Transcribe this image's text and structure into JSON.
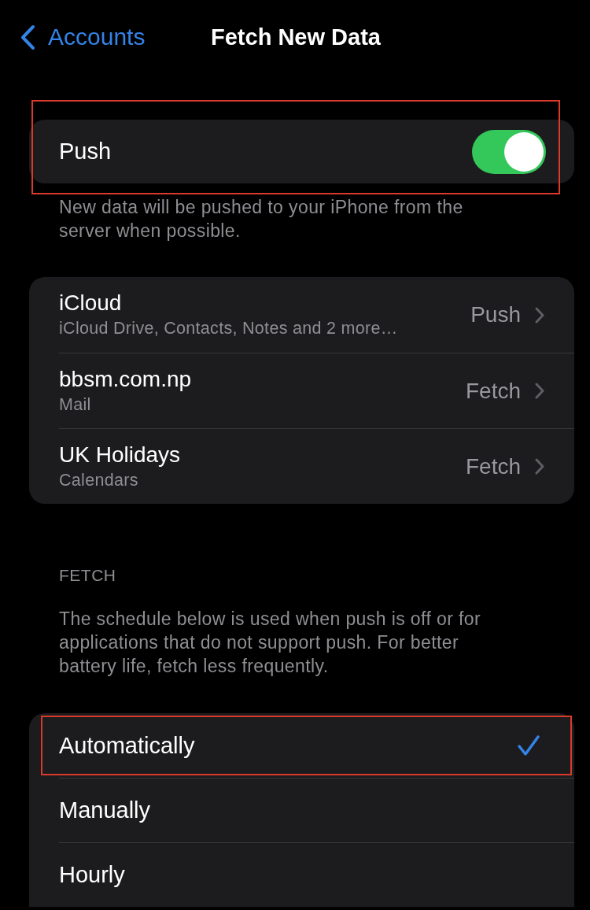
{
  "nav": {
    "back_label": "Accounts",
    "title": "Fetch New Data"
  },
  "push": {
    "label": "Push",
    "on": true,
    "highlighted": true,
    "footer": "New data will be pushed to your iPhone from the server when possible."
  },
  "accounts": [
    {
      "name": "iCloud",
      "detail": "iCloud Drive, Contacts, Notes and 2 more…",
      "value": "Push"
    },
    {
      "name": "bbsm.com.np",
      "detail": "Mail",
      "value": "Fetch"
    },
    {
      "name": "UK Holidays",
      "detail": "Calendars",
      "value": "Fetch"
    }
  ],
  "fetch": {
    "header": "FETCH",
    "description": "The schedule below is used when push is off or for applications that do not support push. For better battery life, fetch less frequently.",
    "options": [
      {
        "label": "Automatically",
        "selected": true,
        "highlighted": true
      },
      {
        "label": "Manually",
        "selected": false,
        "highlighted": false
      },
      {
        "label": "Hourly",
        "selected": false,
        "highlighted": false
      }
    ]
  }
}
